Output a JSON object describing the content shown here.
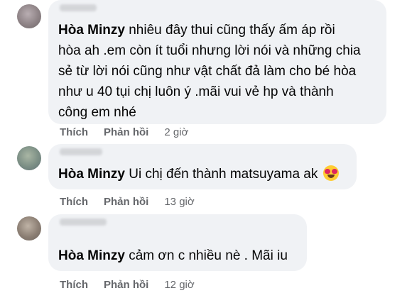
{
  "comments": [
    {
      "author": "Hòa Minzy",
      "text_lines": [
        " nhiêu đây thui cũng thấy ấm áp rồi",
        "hòa ah .em còn ít tuổi nhưng lời nói và những chia",
        "sẻ từ lời nói cũng như vật chất đả làm cho bé hòa",
        "như u 40 tụi chị luôn ý .mãi vui vẻ hp và thành",
        "công em nhé"
      ],
      "like_label": "Thích",
      "reply_label": "Phản hồi",
      "time": "2 giờ"
    },
    {
      "author": "Hòa Minzy",
      "text": " Ui chị đến thành matsuyama ak",
      "emoji": "heart-eyes-emoji",
      "like_label": "Thích",
      "reply_label": "Phản hồi",
      "time": "13 giờ"
    },
    {
      "author": "Hòa Minzy",
      "text": " cảm ơn c nhiều nè . Mãi iu",
      "like_label": "Thích",
      "reply_label": "Phản hồi",
      "time": "12 giờ"
    }
  ]
}
